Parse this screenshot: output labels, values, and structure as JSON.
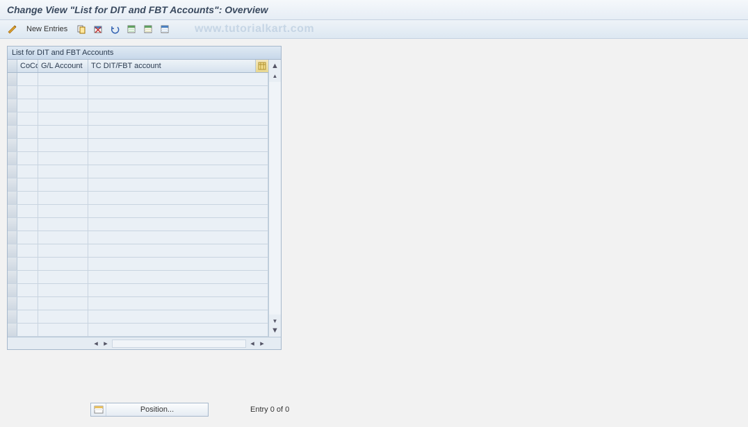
{
  "title": "Change View \"List for DIT and FBT Accounts\": Overview",
  "toolbar": {
    "new_entries": "New Entries"
  },
  "watermark": "www.tutorialkart.com",
  "panel": {
    "header": "List for DIT and FBT Accounts",
    "columns": {
      "cocd": "CoCd",
      "gl": "G/L Account",
      "tc": "TC DIT/FBT account"
    }
  },
  "footer": {
    "position_label": "Position...",
    "entry_text": "Entry 0 of 0"
  }
}
